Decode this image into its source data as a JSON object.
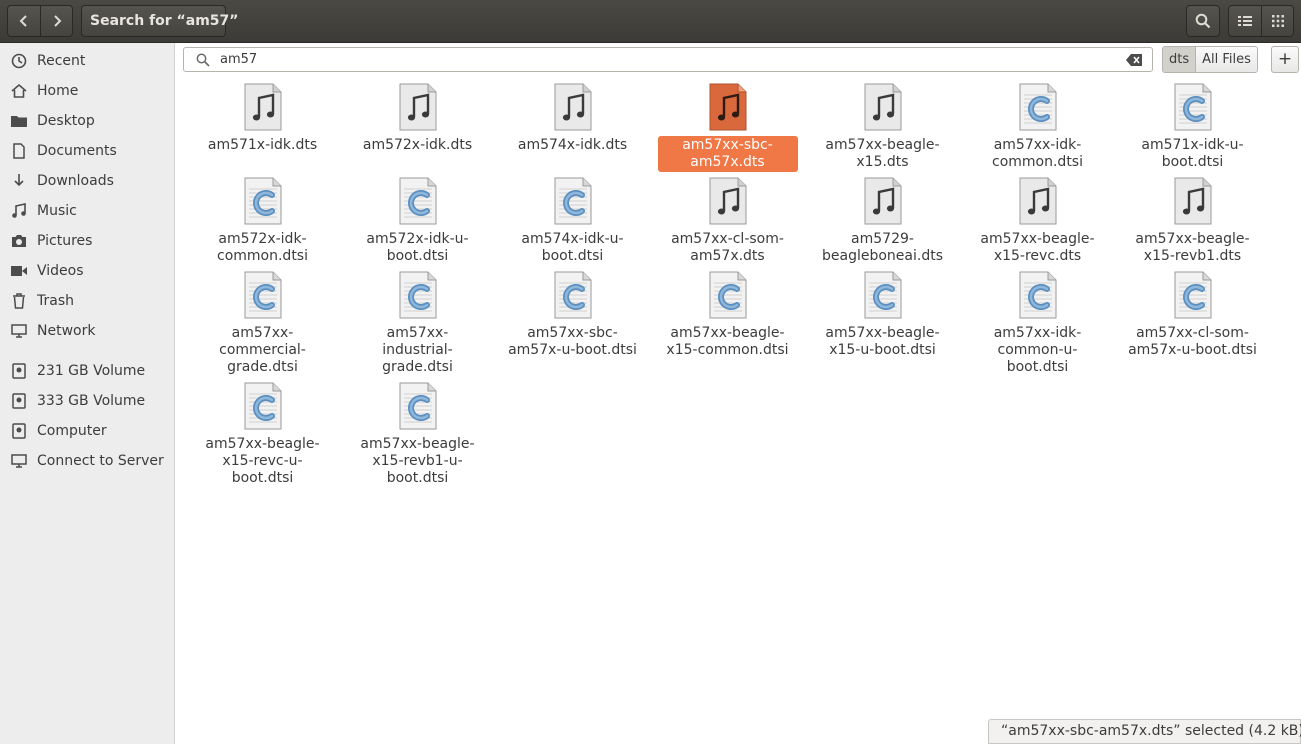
{
  "header": {
    "title": "Search for “am57”",
    "back_icon": "go-back-icon",
    "forward_icon": "go-forward-icon"
  },
  "sidebar": {
    "items": [
      {
        "label": "Recent",
        "icon": "clock-icon"
      },
      {
        "label": "Home",
        "icon": "home-icon"
      },
      {
        "label": "Desktop",
        "icon": "folder-icon"
      },
      {
        "label": "Documents",
        "icon": "document-icon"
      },
      {
        "label": "Downloads",
        "icon": "download-icon"
      },
      {
        "label": "Music",
        "icon": "music-icon"
      },
      {
        "label": "Pictures",
        "icon": "camera-icon"
      },
      {
        "label": "Videos",
        "icon": "video-icon"
      },
      {
        "label": "Trash",
        "icon": "trash-icon"
      },
      {
        "label": "Network",
        "icon": "network-icon"
      }
    ],
    "devices": [
      {
        "label": "231 GB Volume",
        "icon": "drive-icon"
      },
      {
        "label": "333 GB Volume",
        "icon": "drive-icon"
      },
      {
        "label": "Computer",
        "icon": "drive-icon"
      },
      {
        "label": "Connect to Server",
        "icon": "server-icon"
      }
    ]
  },
  "search": {
    "query": "am57",
    "filters": [
      "dts",
      "All Files"
    ],
    "active_filter": "dts",
    "add_label": "+"
  },
  "files": [
    {
      "name": "am571x-idk.dts",
      "type": "audio"
    },
    {
      "name": "am572x-idk.dts",
      "type": "audio"
    },
    {
      "name": "am574x-idk.dts",
      "type": "audio"
    },
    {
      "name": "am57xx-sbc-am57x.dts",
      "type": "audio",
      "selected": true
    },
    {
      "name": "am57xx-beagle-x15.dts",
      "type": "audio"
    },
    {
      "name": "am57xx-idk-common.dtsi",
      "type": "c"
    },
    {
      "name": "am571x-idk-u-boot.dtsi",
      "type": "c"
    },
    {
      "name": "am572x-idk-common.dtsi",
      "type": "c"
    },
    {
      "name": "am572x-idk-u-boot.dtsi",
      "type": "c"
    },
    {
      "name": "am574x-idk-u-boot.dtsi",
      "type": "c"
    },
    {
      "name": "am57xx-cl-som-am57x.dts",
      "type": "audio"
    },
    {
      "name": "am5729-beagleboneai.dts",
      "type": "audio"
    },
    {
      "name": "am57xx-beagle-x15-revc.dts",
      "type": "audio"
    },
    {
      "name": "am57xx-beagle-x15-revb1.dts",
      "type": "audio"
    },
    {
      "name": "am57xx-commercial-grade.dtsi",
      "type": "c"
    },
    {
      "name": "am57xx-industrial-grade.dtsi",
      "type": "c"
    },
    {
      "name": "am57xx-sbc-am57x-u-boot.dtsi",
      "type": "c"
    },
    {
      "name": "am57xx-beagle-x15-common.dtsi",
      "type": "c"
    },
    {
      "name": "am57xx-beagle-x15-u-boot.dtsi",
      "type": "c"
    },
    {
      "name": "am57xx-idk-common-u-boot.dtsi",
      "type": "c"
    },
    {
      "name": "am57xx-cl-som-am57x-u-boot.dtsi",
      "type": "c"
    },
    {
      "name": "am57xx-beagle-x15-revc-u-boot.dtsi",
      "type": "c"
    },
    {
      "name": "am57xx-beagle-x15-revb1-u-boot.dtsi",
      "type": "c"
    }
  ],
  "status": {
    "text": "“am57xx-sbc-am57x.dts” selected  (4.2 kB)"
  },
  "colors": {
    "selection": "#f07746",
    "headerbar": "#3c3b37",
    "sidebar": "#ededed"
  }
}
